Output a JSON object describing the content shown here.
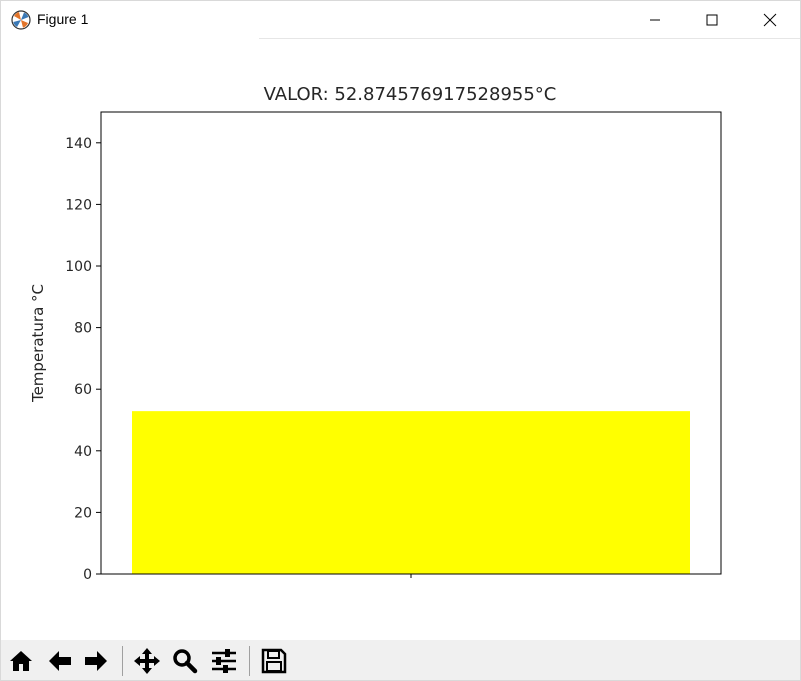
{
  "window": {
    "title": "Figure 1",
    "icons": {
      "app": "matplotlib-icon",
      "minimize": "minimize-icon",
      "maximize": "maximize-icon",
      "close": "close-icon"
    }
  },
  "toolbar": {
    "buttons": [
      {
        "name": "home",
        "icon": "home-icon"
      },
      {
        "name": "back",
        "icon": "back-arrow-icon"
      },
      {
        "name": "forward",
        "icon": "forward-arrow-icon"
      },
      {
        "name": "pan",
        "icon": "pan-move-icon"
      },
      {
        "name": "zoom",
        "icon": "zoom-magnifier-icon"
      },
      {
        "name": "configure-subplots",
        "icon": "sliders-icon"
      },
      {
        "name": "save",
        "icon": "save-floppy-icon"
      }
    ]
  },
  "chart_data": {
    "type": "bar",
    "title": "VALOR: 52.874576917528955°C",
    "xlabel": "",
    "ylabel": "Temperatura °C",
    "categories": [
      ""
    ],
    "values": [
      52.874576917528955
    ],
    "ylim": [
      0,
      150
    ],
    "yticks": [
      0,
      20,
      40,
      60,
      80,
      100,
      120,
      140
    ],
    "ytick_labels": [
      "0",
      "20",
      "40",
      "60",
      "80",
      "100",
      "120",
      "140"
    ],
    "bar_color": "#ffff00",
    "grid": false,
    "legend": "none"
  }
}
